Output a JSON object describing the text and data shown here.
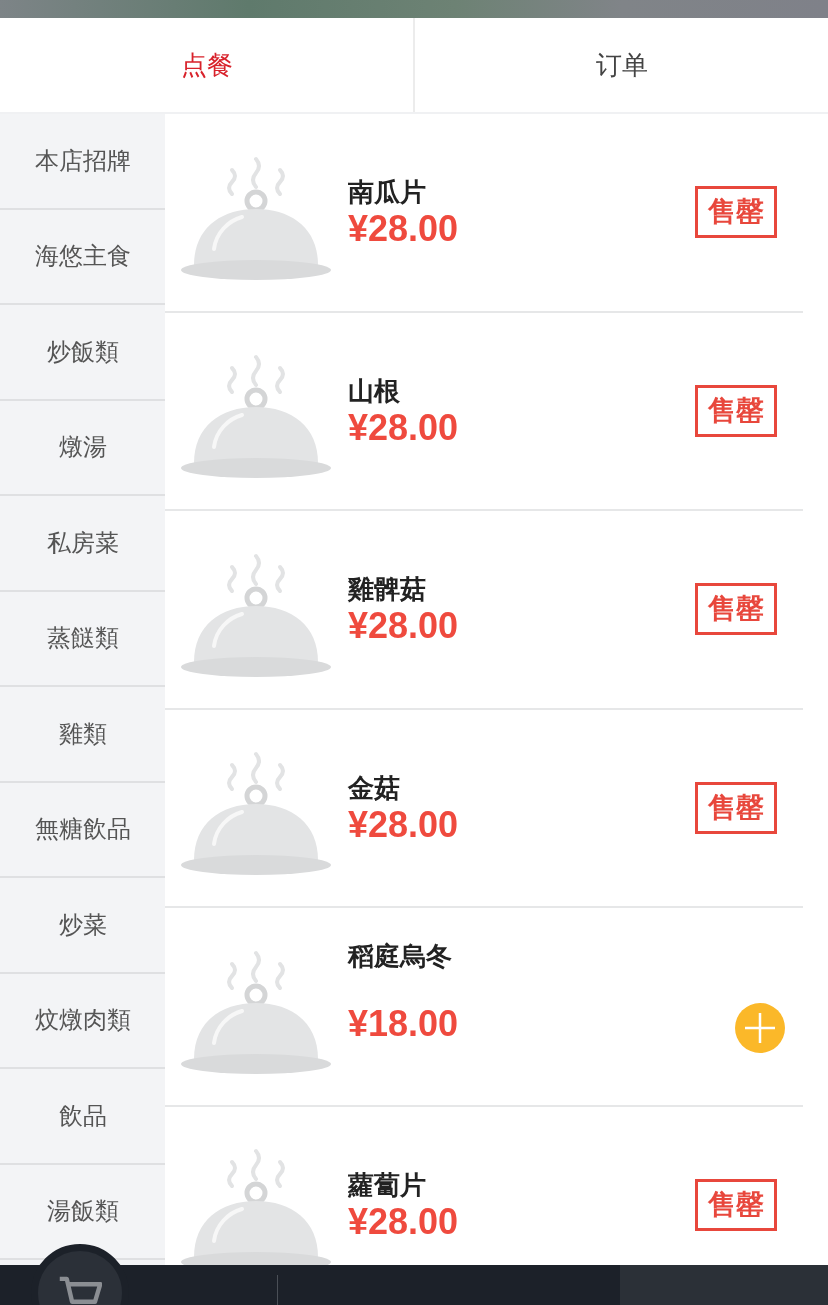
{
  "tabs": [
    {
      "label": "点餐",
      "selected": true
    },
    {
      "label": "订单",
      "selected": false
    }
  ],
  "categories": [
    {
      "label": "本店招牌",
      "selected": false
    },
    {
      "label": "海悠主食",
      "selected": false
    },
    {
      "label": "炒飯類",
      "selected": false
    },
    {
      "label": "燉湯",
      "selected": false
    },
    {
      "label": "私房菜",
      "selected": false
    },
    {
      "label": "蒸餸類",
      "selected": false
    },
    {
      "label": "雞類",
      "selected": false
    },
    {
      "label": "無糖飲品",
      "selected": false
    },
    {
      "label": "炒菜",
      "selected": false
    },
    {
      "label": "炆燉肉類",
      "selected": false
    },
    {
      "label": "飲品",
      "selected": false
    },
    {
      "label": "湯飯類",
      "selected": false
    }
  ],
  "dishes": [
    {
      "name": "南瓜片",
      "price": "¥28.00",
      "sold_out": true,
      "badge": "售罄"
    },
    {
      "name": "山根",
      "price": "¥28.00",
      "sold_out": true,
      "badge": "售罄"
    },
    {
      "name": "雞髀菇",
      "price": "¥28.00",
      "sold_out": true,
      "badge": "售罄"
    },
    {
      "name": "金菇",
      "price": "¥28.00",
      "sold_out": true,
      "badge": "售罄"
    },
    {
      "name": "稻庭烏冬",
      "price": "¥18.00",
      "sold_out": false
    },
    {
      "name": "蘿蔔片",
      "price": "¥28.00",
      "sold_out": true,
      "badge": "售罄"
    }
  ]
}
